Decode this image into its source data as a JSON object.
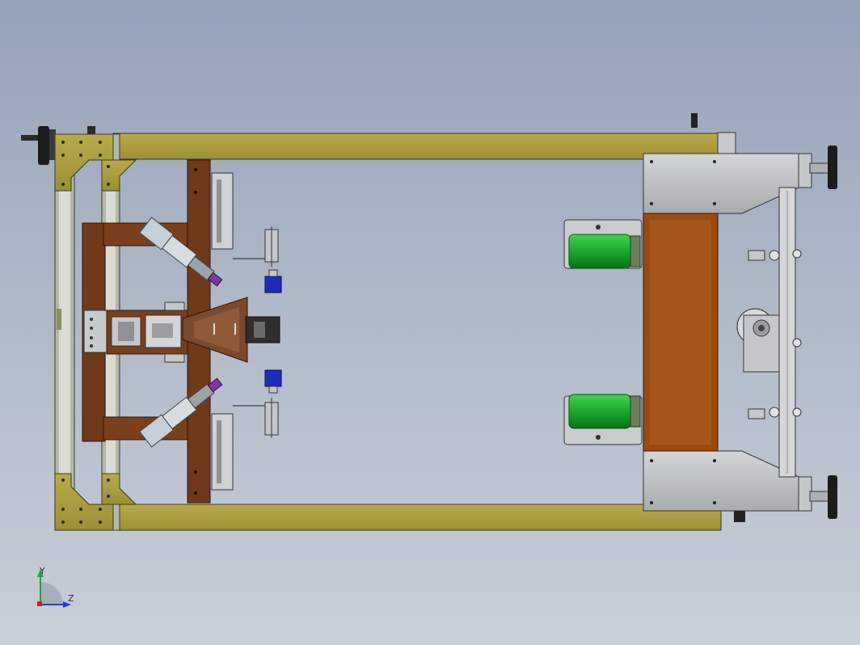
{
  "view": {
    "background_top": "#95a3b8",
    "background_bottom": "#c9cfd8"
  },
  "colors": {
    "frame_yellow": "#a99b3f",
    "frame_yellow_light": "#c9bb5a",
    "wood_brown": "#6e3a1a",
    "wood_brown_light": "#8a4a22",
    "orange_panel": "#9a4a10",
    "steel_gray": "#bfc2c4",
    "steel_dark": "#6d7072",
    "roller_green": "#1aa72c",
    "blue_block": "#1f2bb8",
    "purple_fitting": "#7b3aa0"
  },
  "triad": {
    "y_label": "Y",
    "z_label": "Z",
    "y_color": "#1fa63a",
    "z_color": "#2a3ad8"
  }
}
